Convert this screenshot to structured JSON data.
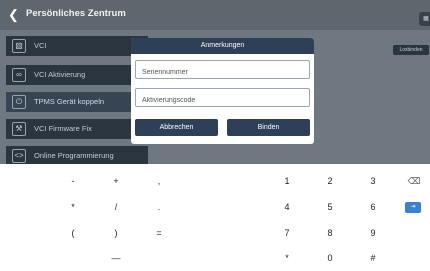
{
  "header": {
    "title": "Persönliches Zentrum",
    "back_icon": "chevron-left-icon"
  },
  "sidebar": {
    "items": [
      {
        "label": "VCI",
        "icon": "vci-icon"
      },
      {
        "label": "VCI Aktivierung",
        "icon": "link-icon"
      },
      {
        "label": "TPMS Gerät koppeln",
        "icon": "power-icon"
      },
      {
        "label": "VCI Firmware Fix",
        "icon": "wrench-icon"
      },
      {
        "label": "Online Programmierung",
        "icon": "code-icon"
      }
    ]
  },
  "main": {
    "unbind_button": "Losbinden"
  },
  "dialog": {
    "title": "Anmerkungen",
    "serial_placeholder": "Seriennummer",
    "activation_placeholder": "Aktivierungscode",
    "cancel_label": "Abbrechen",
    "confirm_label": "Binden"
  },
  "keyboard": {
    "symbols": {
      "minus": "-",
      "plus": "+",
      "comma": ",",
      "asterisk": "*",
      "slash": "/",
      "period": ".",
      "lparen": "(",
      "rparen": ")",
      "equals": "=",
      "dash": "—"
    },
    "digits": {
      "d1": "1",
      "d2": "2",
      "d3": "3",
      "d4": "4",
      "d5": "5",
      "d6": "6",
      "d7": "7",
      "d8": "8",
      "d9": "9",
      "d0": "0",
      "star": "*",
      "hash": "#"
    },
    "backspace_glyph": "⌫",
    "enter_glyph": "⇥"
  },
  "colors": {
    "header_bg": "#5e666e",
    "dialog_header": "#2e3f58",
    "sidebar_item": "#2b3540",
    "enter_key": "#3a7fd0"
  }
}
